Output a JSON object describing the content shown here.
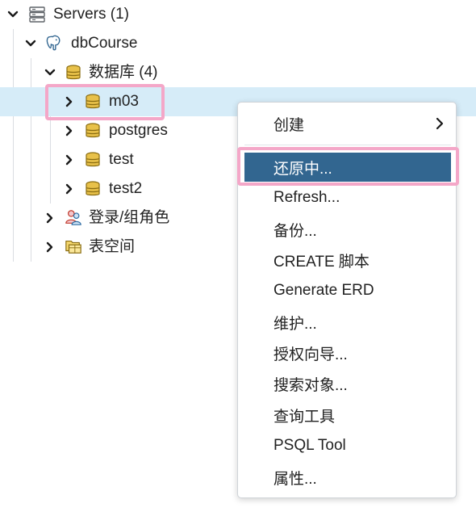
{
  "tree": {
    "servers": {
      "label": "Servers (1)",
      "icon": "servers-icon",
      "expanded": true
    },
    "server": {
      "label": "dbCourse",
      "icon": "postgres-elephant-icon",
      "expanded": true
    },
    "databases": {
      "label": "数据库 (4)",
      "icon": "database-icon",
      "expanded": true
    },
    "database_items": [
      {
        "label": "m03",
        "icon": "database-icon",
        "selected": true
      },
      {
        "label": "postgres",
        "icon": "database-icon"
      },
      {
        "label": "test",
        "icon": "database-icon"
      },
      {
        "label": "test2",
        "icon": "database-icon"
      }
    ],
    "login_roles": {
      "label": "登录/组角色",
      "icon": "login-roles-icon"
    },
    "tablespaces": {
      "label": "表空间",
      "icon": "tablespace-folder-icon"
    }
  },
  "context_menu": {
    "items": [
      {
        "label": "创建",
        "has_submenu": true
      },
      {
        "label": "还原中...",
        "active": true
      },
      {
        "label": "Refresh..."
      },
      {
        "label": "备份..."
      },
      {
        "label": "CREATE 脚本"
      },
      {
        "label": "Generate ERD"
      },
      {
        "label": "维护..."
      },
      {
        "label": "授权向导..."
      },
      {
        "label": "搜索对象..."
      },
      {
        "label": "查询工具"
      },
      {
        "label": "PSQL Tool"
      },
      {
        "label": "属性..."
      }
    ]
  },
  "colors": {
    "selection_bg": "#d6ecf8",
    "menu_active_bg": "#326690",
    "highlight_border": "#f4a7c8",
    "db_icon": "#c9a227"
  }
}
